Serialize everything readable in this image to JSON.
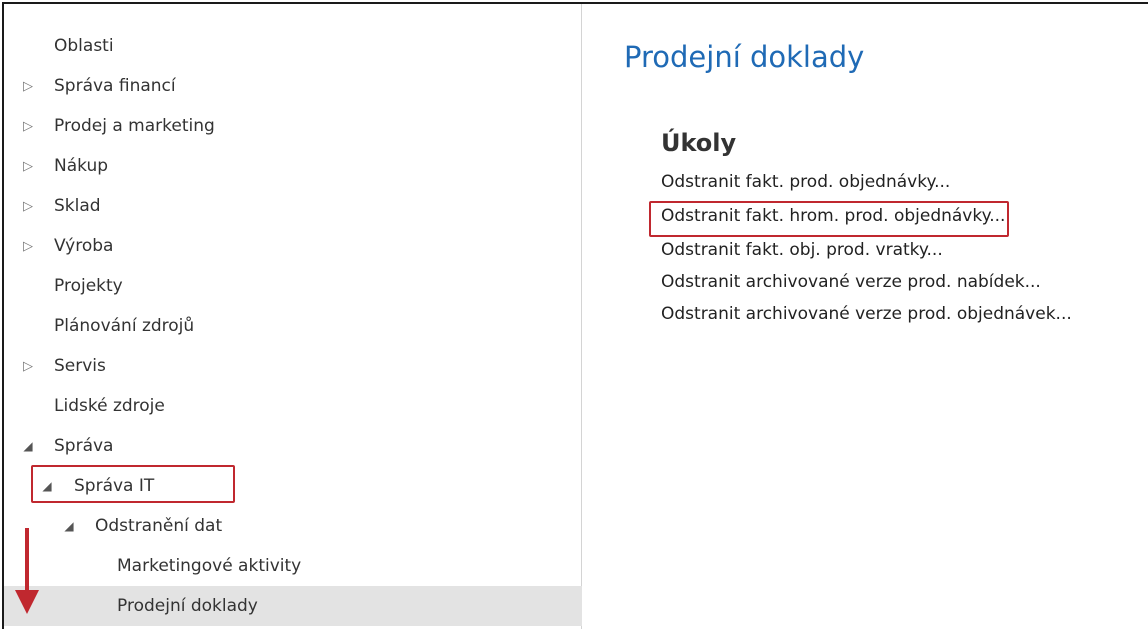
{
  "navigation": {
    "items": [
      {
        "label": "Oblasti",
        "expander": "none"
      },
      {
        "label": "Správa financí",
        "expander": "collapsed"
      },
      {
        "label": "Prodej a marketing",
        "expander": "collapsed"
      },
      {
        "label": "Nákup",
        "expander": "collapsed"
      },
      {
        "label": "Sklad",
        "expander": "collapsed"
      },
      {
        "label": "Výroba",
        "expander": "collapsed"
      },
      {
        "label": "Projekty",
        "expander": "none"
      },
      {
        "label": "Plánování zdrojů",
        "expander": "none"
      },
      {
        "label": "Servis",
        "expander": "collapsed"
      },
      {
        "label": "Lidské zdroje",
        "expander": "none"
      },
      {
        "label": "Správa",
        "expander": "expanded"
      },
      {
        "label": "Správa IT",
        "expander": "expanded"
      },
      {
        "label": "Odstranění dat",
        "expander": "expanded"
      },
      {
        "label": "Marketingové aktivity",
        "expander": "none"
      },
      {
        "label": "Prodejní doklady",
        "expander": "none",
        "selected": true
      }
    ],
    "icons": {
      "collapsed": "▷",
      "expanded": "◢"
    }
  },
  "content": {
    "title": "Prodejní doklady",
    "section_title": "Úkoly",
    "tasks": [
      "Odstranit fakt. prod. objednávky...",
      "Odstranit fakt. hrom. prod. objednávky...",
      "Odstranit fakt. obj. prod. vratky...",
      "Odstranit archivované verze prod. nabídek...",
      "Odstranit archivované verze prod. objednávek..."
    ]
  },
  "colors": {
    "accent_title": "#1f6ab5",
    "highlight_box": "#c0282f",
    "selected_row": "#e3e3e3"
  }
}
